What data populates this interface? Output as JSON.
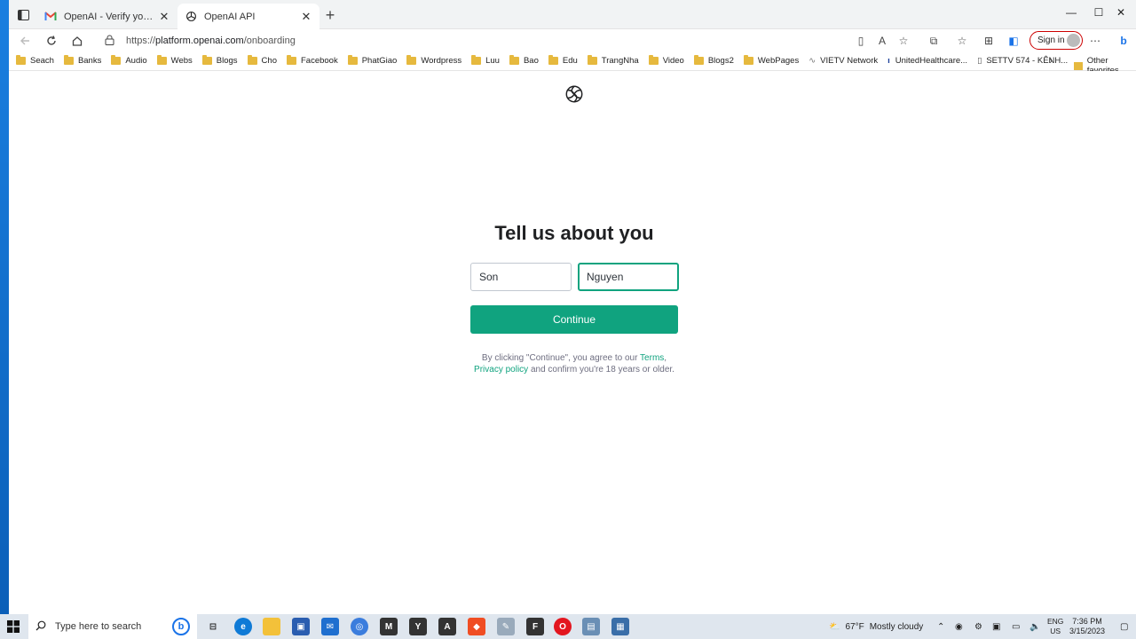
{
  "browser": {
    "tabs": [
      {
        "title": "OpenAI - Verify your email - ngu",
        "active": false
      },
      {
        "title": "OpenAI API",
        "active": true
      }
    ],
    "address": {
      "prefix": "https://",
      "host": "platform.openai.com",
      "path": "/onboarding"
    },
    "signin_label": "Sign in",
    "bookmarks": [
      "Seach",
      "Banks",
      "Audio",
      "Webs",
      "Blogs",
      "Cho",
      "Facebook",
      "PhatGiao",
      "Wordpress",
      "Luu",
      "Bao",
      "Edu",
      "TrangNha",
      "Video",
      "Blogs2",
      "WebPages",
      "VIETV Network",
      "UnitedHealthcare...",
      "SETTV 574 - KÊNH..."
    ],
    "other_favorites": "Other favorites"
  },
  "page": {
    "heading": "Tell us about you",
    "first_name_value": "Son",
    "last_name_value": "Nguyen",
    "continue_label": "Continue",
    "legal": {
      "prefix": "By clicking \"Continue\", you agree to our ",
      "terms": "Terms",
      "comma": ",",
      "privacy": "Privacy policy",
      "suffix": " and confirm you're 18 years or older."
    }
  },
  "taskbar": {
    "search_placeholder": "Type here to search",
    "weather_temp": "67°F",
    "weather_text": "Mostly cloudy",
    "lang_top": "ENG",
    "lang_bottom": "US",
    "time": "7:36 PM",
    "date": "3/15/2023"
  },
  "colors": {
    "accent": "#10a37f",
    "heading": "#202123"
  }
}
